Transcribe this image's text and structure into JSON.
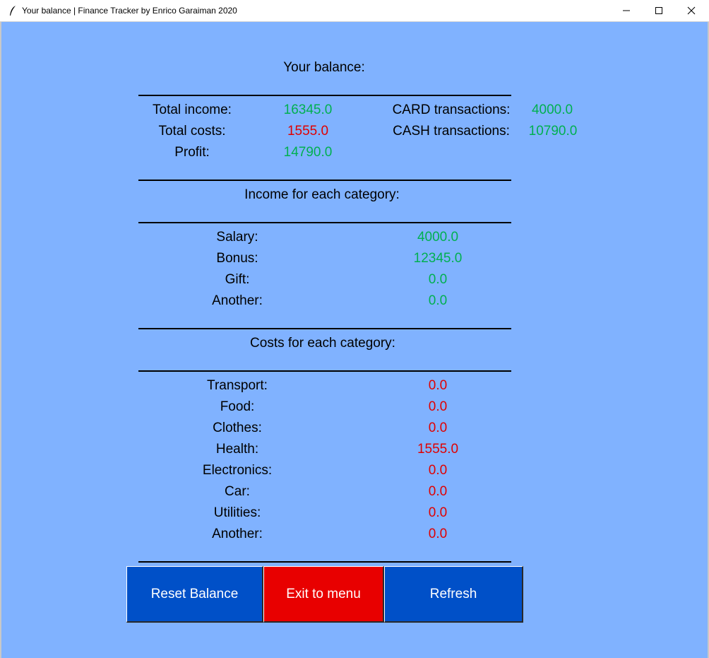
{
  "window": {
    "title": "Your balance | Finance Tracker by Enrico Garaiman 2020",
    "icon": "feather-icon"
  },
  "header": {
    "title": "Your balance:"
  },
  "summary": {
    "total_income_label": "Total income:",
    "total_income_value": "16345.0",
    "total_costs_label": "Total costs:",
    "total_costs_value": "1555.0",
    "profit_label": "Profit:",
    "profit_value": "14790.0",
    "card_label": "CARD transactions:",
    "card_value": "4000.0",
    "cash_label": "CASH transactions:",
    "cash_value": "10790.0"
  },
  "income": {
    "title": "Income for each category:",
    "rows": [
      {
        "label": "Salary:",
        "value": "4000.0"
      },
      {
        "label": "Bonus:",
        "value": "12345.0"
      },
      {
        "label": "Gift:",
        "value": "0.0"
      },
      {
        "label": "Another:",
        "value": "0.0"
      }
    ]
  },
  "costs": {
    "title": "Costs for each category:",
    "rows": [
      {
        "label": "Transport:",
        "value": "0.0"
      },
      {
        "label": "Food:",
        "value": "0.0"
      },
      {
        "label": "Clothes:",
        "value": "0.0"
      },
      {
        "label": "Health:",
        "value": "1555.0"
      },
      {
        "label": "Electronics:",
        "value": "0.0"
      },
      {
        "label": "Car:",
        "value": "0.0"
      },
      {
        "label": "Utilities:",
        "value": "0.0"
      },
      {
        "label": "Another:",
        "value": "0.0"
      }
    ]
  },
  "buttons": {
    "reset": "Reset Balance",
    "exit": "Exit to menu",
    "refresh": "Refresh"
  },
  "colors": {
    "background": "#80b2ff",
    "positive": "#00b050",
    "negative": "#e00000",
    "button_blue": "#0050c8",
    "button_red": "#e80000"
  }
}
